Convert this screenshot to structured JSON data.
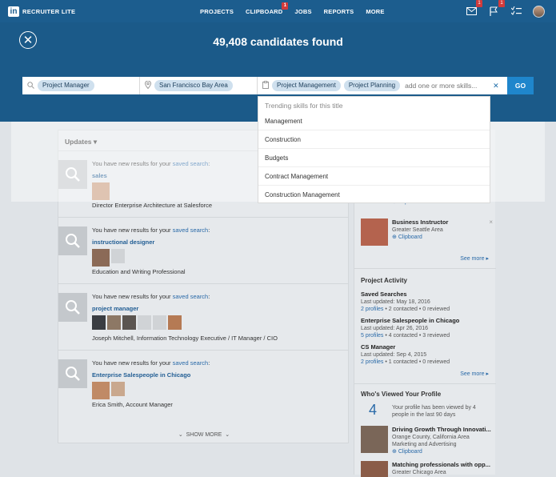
{
  "nav": {
    "brand": "RECRUITER LITE",
    "links": [
      "PROJECTS",
      "CLIPBOARD",
      "JOBS",
      "REPORTS",
      "MORE"
    ],
    "clipboard_badge": "1",
    "messages_badge": "1",
    "flags_badge": "1"
  },
  "overlay": {
    "results_title": "49,408 candidates found",
    "title_chip": "Project Manager",
    "location_chip": "San Francisco Bay Area",
    "skill_chips": [
      "Project Management",
      "Project Planning"
    ],
    "skill_placeholder": "add one or more skills...",
    "go_label": "GO",
    "dropdown_heading": "Trending skills for this title",
    "dropdown_items": [
      "Management",
      "Construction",
      "Budgets",
      "Contract Management",
      "Construction Management"
    ]
  },
  "updates": {
    "header": "Updates ▾",
    "new_results_prefix": "You have new results for your",
    "saved_search_link": "saved search",
    "items": [
      {
        "search": "sales",
        "desc": "Director Enterprise Architecture at Salesforce"
      },
      {
        "search": "instructional designer",
        "desc": "Education and Writing Professional"
      },
      {
        "search": "project manager",
        "desc_name": "Joseph Mitchell",
        "desc": ", Information Technology Executive / IT Manager / CIO"
      },
      {
        "search": "Enterprise Salespeople in Chicago",
        "desc_name": "Erica Smith",
        "desc": ", Account Manager"
      }
    ],
    "show_more": "SHOW MORE"
  },
  "right": {
    "clipboard_partial": "Clipboard",
    "person1": {
      "name": "Business Instructor",
      "loc": "Greater Seattle Area",
      "clip": "Clipboard"
    },
    "see_more_1": "See more ▸",
    "project_activity_title": "Project Activity",
    "projects": [
      {
        "name": "Saved Searches",
        "updated": "Last updated: May 18, 2016",
        "profiles": "2 profiles",
        "contacted": "2 contacted",
        "reviewed": "0 reviewed"
      },
      {
        "name": "Enterprise Salespeople in Chicago",
        "updated": "Last updated: Apr 26, 2016",
        "profiles": "5 profiles",
        "contacted": "4 contacted",
        "reviewed": "3 reviewed"
      },
      {
        "name": "CS Manager",
        "updated": "Last updated: Sep 4, 2015",
        "profiles": "2 profiles",
        "contacted": "1 contacted",
        "reviewed": "0 reviewed"
      }
    ],
    "see_more_2": "See more ▸",
    "viewed_title": "Who's Viewed Your Profile",
    "views_count": "4",
    "views_text": "Your profile has been viewed by 4 people in the last 90 days",
    "viewer1": {
      "name": "Driving Growth Through Innovati...",
      "loc": "Orange County, California Area",
      "loc2": "Marketing and Advertising",
      "clip": "Clipboard"
    },
    "viewer2": {
      "name": "Matching professionals with opp...",
      "loc": "Greater Chicago Area"
    }
  }
}
